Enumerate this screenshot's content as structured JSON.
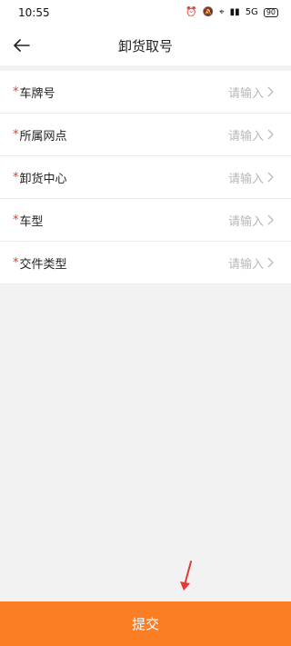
{
  "status": {
    "time": "10:55",
    "battery": "90",
    "signal": "5G"
  },
  "header": {
    "title": "卸货取号"
  },
  "form": {
    "required_mark": "*",
    "placeholder": "请输入",
    "rows": [
      {
        "label": "车牌号"
      },
      {
        "label": "所属网点"
      },
      {
        "label": "卸货中心"
      },
      {
        "label": "车型"
      },
      {
        "label": "交件类型"
      }
    ]
  },
  "footer": {
    "submit_label": "提交"
  },
  "colors": {
    "accent": "#fb7d24",
    "required": "#e53935",
    "annotation": "#e53935"
  },
  "icons": [
    "back-arrow-icon",
    "chevron-right-icon",
    "alarm-icon",
    "mute-icon",
    "location-icon",
    "signal-icon",
    "battery-icon"
  ]
}
